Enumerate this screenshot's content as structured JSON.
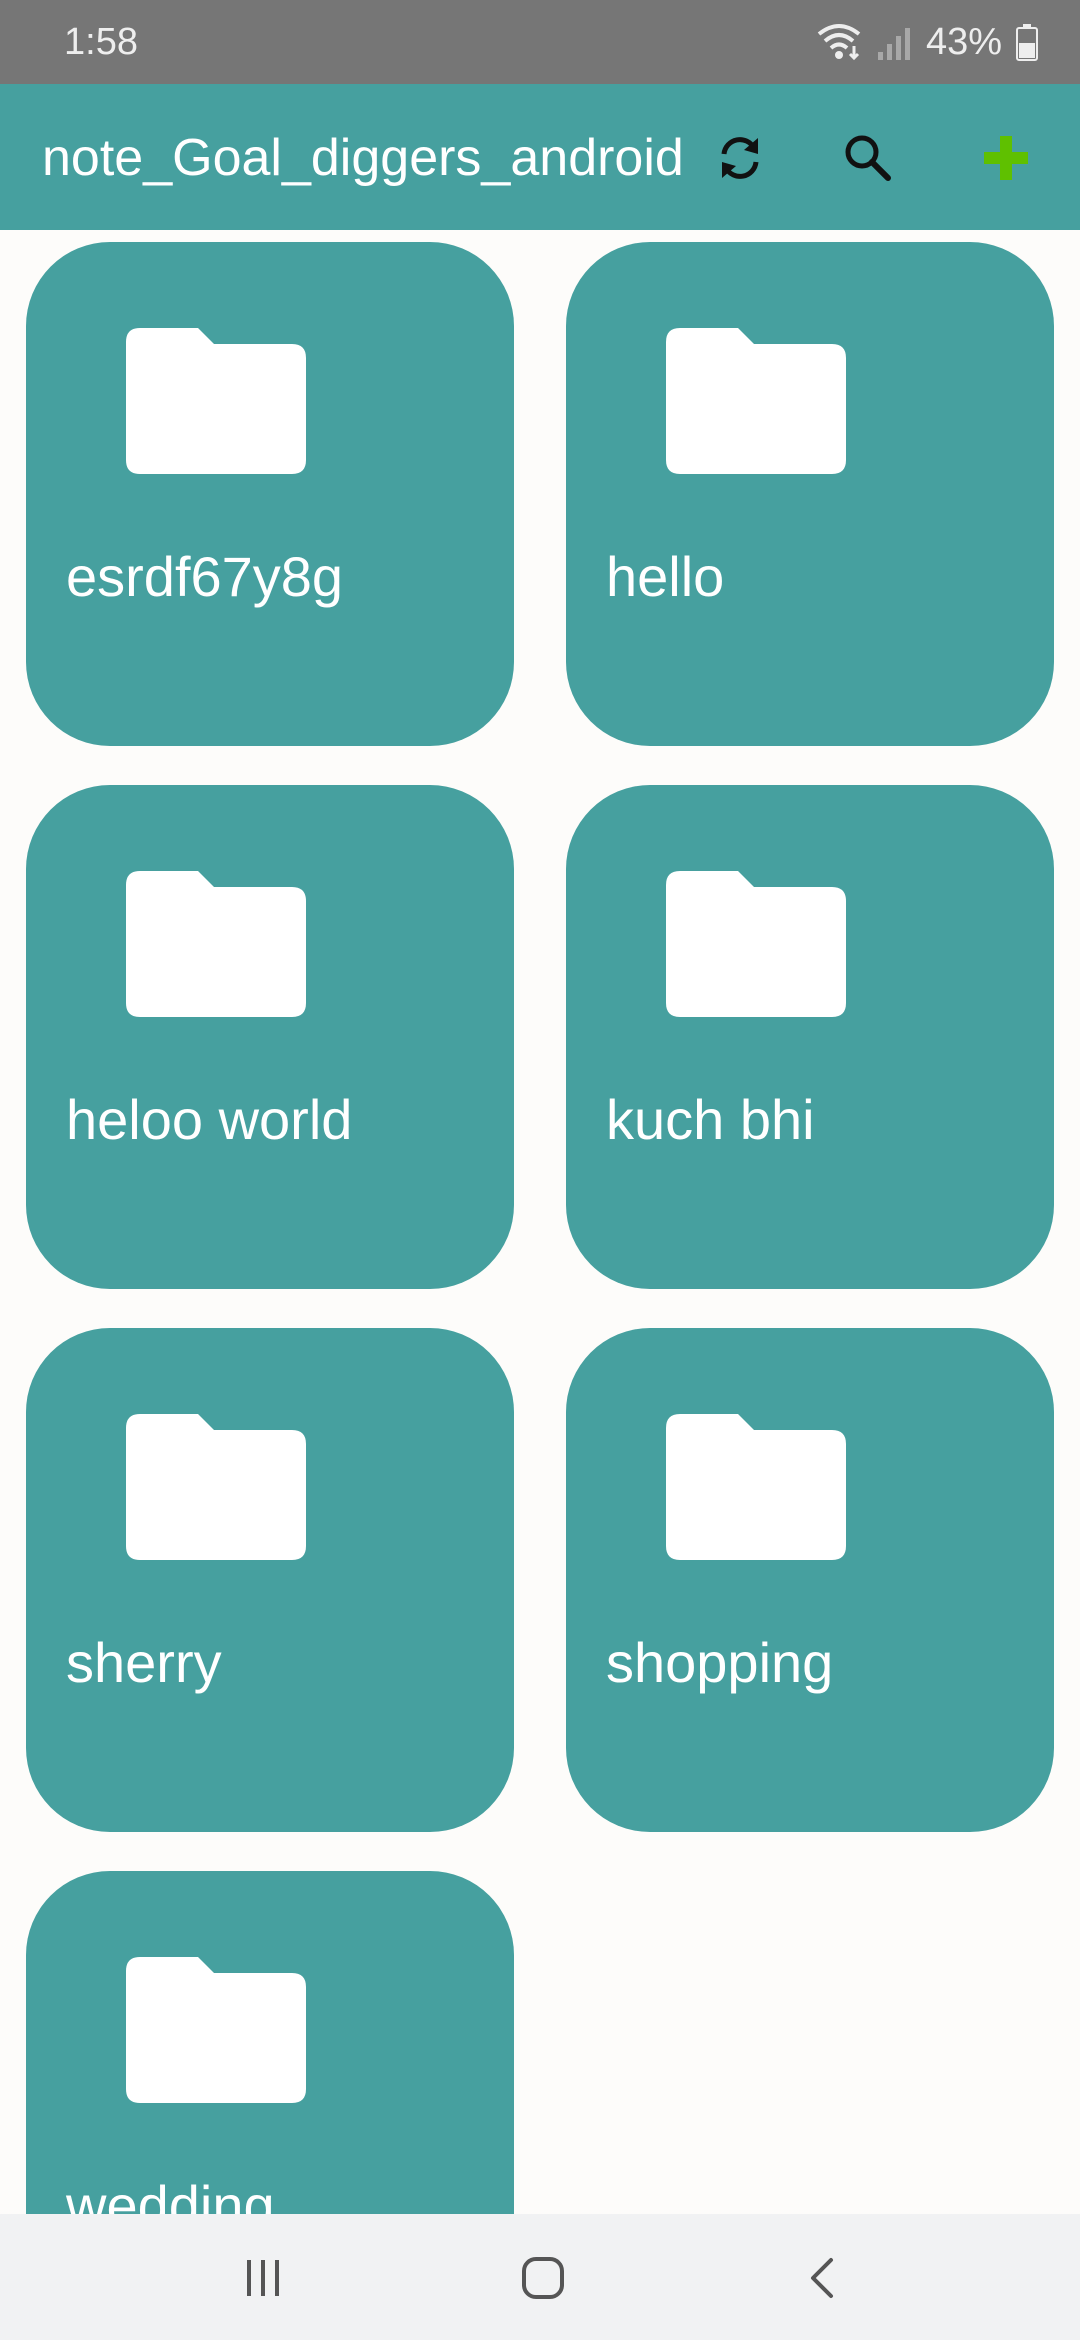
{
  "status_bar": {
    "time": "1:58",
    "battery_percent": "43%",
    "icons": [
      "wifi-icon",
      "signal-icon",
      "battery-icon"
    ]
  },
  "app_bar": {
    "title": "note_Goal_diggers_android",
    "icons": [
      "sync-icon",
      "search-icon",
      "add-icon"
    ],
    "colors": {
      "background": "#46a09f",
      "add_icon": "#5fc000"
    }
  },
  "folders": [
    {
      "name": "esrdf67y8g"
    },
    {
      "name": "hello"
    },
    {
      "name": "heloo world"
    },
    {
      "name": "kuch bhi"
    },
    {
      "name": "sherry"
    },
    {
      "name": "shopping"
    },
    {
      "name": "wedding"
    }
  ],
  "nav_bar": {
    "icons": [
      "recent-apps-icon",
      "home-icon",
      "back-icon"
    ]
  },
  "colors": {
    "accent": "#46a09f",
    "page_background": "#fdfcfa",
    "status_bar": "#767676",
    "nav_bar": "#f1f2f3"
  }
}
